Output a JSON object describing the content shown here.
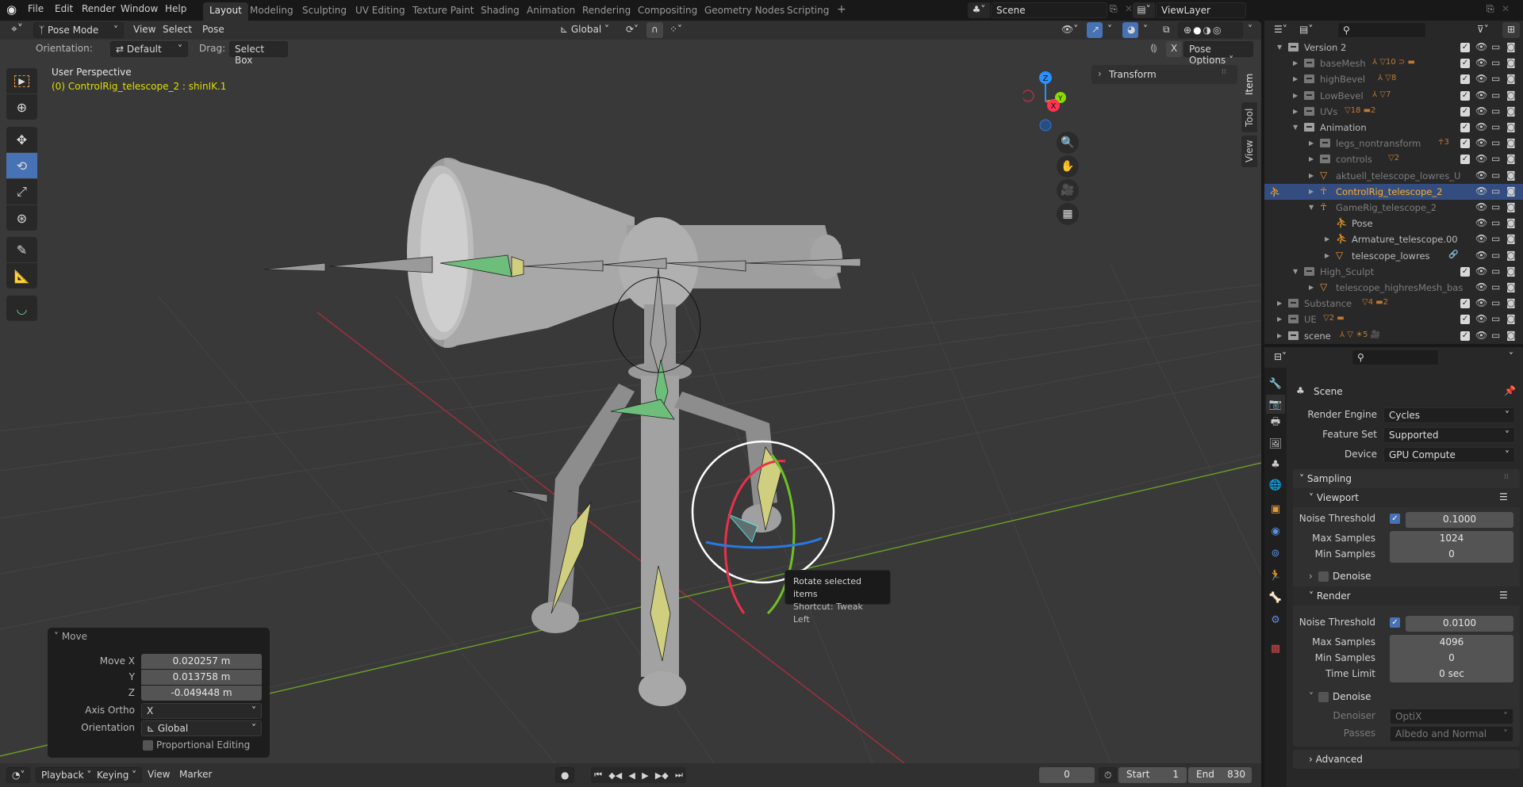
{
  "topbar": {
    "menus": [
      "File",
      "Edit",
      "Render",
      "Window",
      "Help"
    ],
    "workspaces": [
      "Layout",
      "Modeling",
      "Sculpting",
      "UV Editing",
      "Texture Paint",
      "Shading",
      "Animation",
      "Rendering",
      "Compositing",
      "Geometry Nodes",
      "Scripting"
    ],
    "active_workspace": "Layout",
    "add_workspace": "+",
    "scene_name": "Scene",
    "view_layer": "ViewLayer"
  },
  "viewport_header": {
    "mode": "Pose Mode",
    "menus": [
      "View",
      "Select",
      "Pose"
    ],
    "transform_orientation": "Global",
    "orientation_label": "Orientation:",
    "orientation_value": "Default",
    "drag_label": "Drag:",
    "drag_value": "Select Box",
    "mirror_axis": "X",
    "pose_options": "Pose Options"
  },
  "viewport": {
    "view_name": "User Perspective",
    "active_info": "(0) ControlRig_telescope_2 : shinIK.1",
    "gizmo_axes": [
      "Z",
      "Y",
      "X"
    ],
    "n_panel_section": "Transform",
    "side_tabs": [
      "Item",
      "Tool",
      "View"
    ],
    "active_tool": "Rotate",
    "tools": [
      "select-box",
      "cursor",
      "move",
      "rotate",
      "scale",
      "transform",
      "annotate",
      "measure",
      "relax-pose"
    ],
    "tooltip": {
      "title": "Rotate selected items",
      "shortcut": "Shortcut: Tweak Left"
    }
  },
  "move_panel": {
    "title": "Move",
    "move_x_label": "Move X",
    "move_x": "0.020257 m",
    "y_label": "Y",
    "y": "0.013758 m",
    "z_label": "Z",
    "z": "-0.049448 m",
    "axis_ortho_label": "Axis Ortho",
    "axis_ortho": "X",
    "orientation_label": "Orientation",
    "orientation": "Global",
    "proportional_editing": "Proportional Editing",
    "proportional_checked": false
  },
  "timeline": {
    "menus": [
      "Playback",
      "Keying",
      "View",
      "Marker"
    ],
    "current_frame": "0",
    "start_label": "Start",
    "start": "1",
    "end_label": "End",
    "end": "830"
  },
  "outliner": {
    "rows": [
      {
        "name": "Version 2",
        "level": 0,
        "expanded": true,
        "type": "collection",
        "dim": false,
        "badges": ""
      },
      {
        "name": "baseMesh",
        "level": 1,
        "expanded": false,
        "type": "collection",
        "dim": true,
        "badges": "⅄ ▽10 ⊃ ▬"
      },
      {
        "name": "highBevel",
        "level": 1,
        "expanded": false,
        "type": "collection",
        "dim": true,
        "badges": "⅄ ▽8"
      },
      {
        "name": "LowBevel",
        "level": 1,
        "expanded": false,
        "type": "collection",
        "dim": true,
        "badges": "⅄ ▽7"
      },
      {
        "name": "UVs",
        "level": 1,
        "expanded": false,
        "type": "collection",
        "dim": true,
        "badges": "▽18 ▬2"
      },
      {
        "name": "Animation",
        "level": 1,
        "expanded": true,
        "type": "collection",
        "dim": false,
        "badges": ""
      },
      {
        "name": "legs_nontransform",
        "level": 2,
        "expanded": false,
        "type": "collection",
        "dim": true,
        "badges": "☥3"
      },
      {
        "name": "controls",
        "level": 2,
        "expanded": false,
        "type": "collection",
        "dim": true,
        "badges": "▽2"
      },
      {
        "name": "aktuell_telescope_lowres_U",
        "level": 2,
        "expanded": false,
        "type": "mesh",
        "dim": true,
        "badges": ""
      },
      {
        "name": "ControlRig_telescope_2",
        "level": 2,
        "expanded": false,
        "type": "armature",
        "dim": false,
        "selected": true,
        "badges": ""
      },
      {
        "name": "GameRig_telescope_2",
        "level": 2,
        "expanded": true,
        "type": "armature",
        "dim": true,
        "badges": ""
      },
      {
        "name": "Pose",
        "level": 3,
        "expanded": null,
        "type": "pose",
        "dim": false,
        "badges": ""
      },
      {
        "name": "Armature_telescope.00",
        "level": 3,
        "expanded": false,
        "type": "pose",
        "dim": false,
        "badges": ""
      },
      {
        "name": "telescope_lowres",
        "level": 3,
        "expanded": false,
        "type": "mesh",
        "dim": false,
        "badges": "🔗"
      },
      {
        "name": "High_Sculpt",
        "level": 1,
        "expanded": true,
        "type": "collection",
        "dim": true,
        "badges": ""
      },
      {
        "name": "telescope_highresMesh_bas",
        "level": 2,
        "expanded": false,
        "type": "mesh",
        "dim": true,
        "badges": ""
      },
      {
        "name": "Substance",
        "level": 0,
        "expanded": false,
        "type": "collection",
        "dim": true,
        "badges": "▽4 ▬2"
      },
      {
        "name": "UE",
        "level": 0,
        "expanded": false,
        "type": "collection",
        "dim": true,
        "badges": "▽2 ▬"
      },
      {
        "name": "scene",
        "level": 0,
        "expanded": false,
        "type": "collection",
        "dim": false,
        "badges": "⅄ ▽ ☀5 🎥"
      }
    ]
  },
  "properties": {
    "context": "Scene",
    "render_engine_label": "Render Engine",
    "render_engine": "Cycles",
    "feature_set_label": "Feature Set",
    "feature_set": "Supported",
    "device_label": "Device",
    "device": "GPU Compute",
    "sampling": "Sampling",
    "viewport": {
      "title": "Viewport",
      "noise_threshold_label": "Noise Threshold",
      "noise_threshold_enabled": true,
      "noise_threshold": "0.1000",
      "max_samples_label": "Max Samples",
      "max_samples": "1024",
      "min_samples_label": "Min Samples",
      "min_samples": "0",
      "denoise_label": "Denoise",
      "denoise_enabled": false
    },
    "render": {
      "title": "Render",
      "noise_threshold_label": "Noise Threshold",
      "noise_threshold_enabled": true,
      "noise_threshold": "0.0100",
      "max_samples_label": "Max Samples",
      "max_samples": "4096",
      "min_samples_label": "Min Samples",
      "min_samples": "0",
      "time_limit_label": "Time Limit",
      "time_limit": "0 sec",
      "denoise_label": "Denoise",
      "denoise_enabled": false,
      "denoiser_label": "Denoiser",
      "denoiser": "OptiX",
      "passes_label": "Passes",
      "passes": "Albedo and Normal"
    },
    "advanced": "Advanced"
  },
  "colors": {
    "accent": "#4772b3",
    "selection_text": "#ffaf29",
    "info_text": "#dfdf00",
    "x_axis": "#ff3352",
    "y_axis": "#8bdc00",
    "z_axis": "#2890ff"
  }
}
